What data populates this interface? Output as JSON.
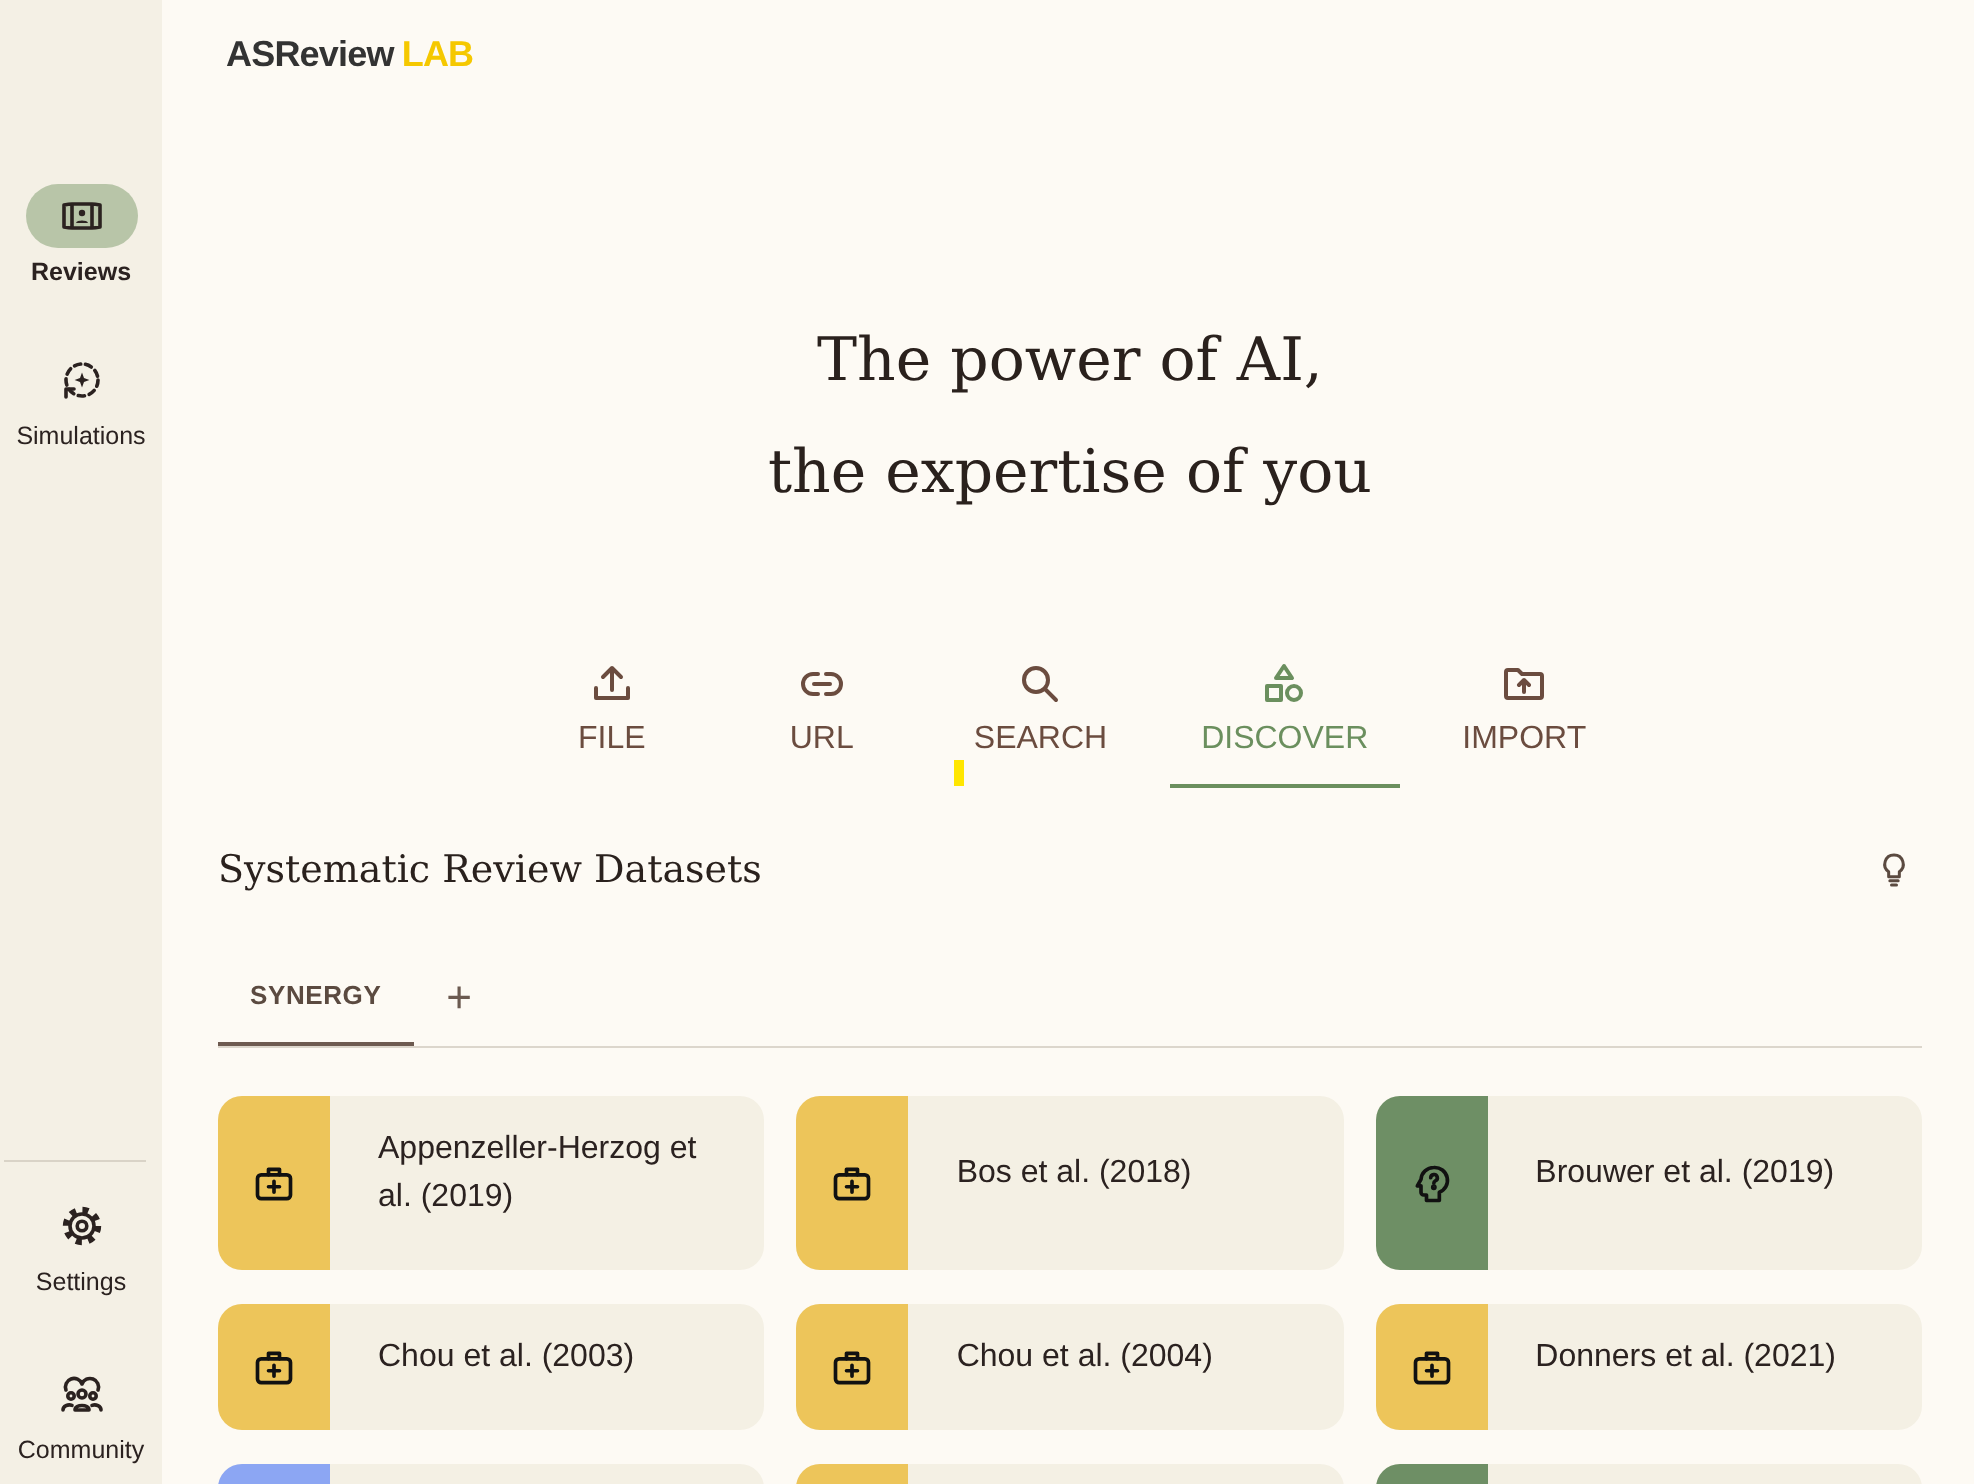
{
  "sidebar": {
    "items": [
      {
        "label": "Reviews",
        "selected": true
      },
      {
        "label": "Simulations",
        "selected": false
      }
    ],
    "bottom_items": [
      {
        "label": "Settings"
      },
      {
        "label": "Community"
      }
    ]
  },
  "logo": {
    "name": "ASReview",
    "suffix": "LAB"
  },
  "headline": [
    "The power of AI,",
    "the expertise of you"
  ],
  "source_tabs": [
    {
      "label": "FILE",
      "selected": false
    },
    {
      "label": "URL",
      "selected": false
    },
    {
      "label": "SEARCH",
      "selected": false
    },
    {
      "label": "DISCOVER",
      "selected": true
    },
    {
      "label": "IMPORT",
      "selected": false
    }
  ],
  "section": {
    "title": "Systematic Review Datasets"
  },
  "dataset_tabs": [
    {
      "label": "SYNERGY",
      "selected": true
    },
    {
      "label": "+",
      "selected": false
    }
  ],
  "datasets": [
    {
      "title": "Appenzeller-Herzog et al. (2019)",
      "kind": "medicine",
      "color": "#edc55a"
    },
    {
      "title": "Bos et al. (2018)",
      "kind": "medicine",
      "color": "#edc55a"
    },
    {
      "title": "Brouwer et al. (2019)",
      "kind": "psychology",
      "color": "#6e8f65"
    },
    {
      "title": "Chou et al. (2003)",
      "kind": "medicine",
      "color": "#edc55a"
    },
    {
      "title": "Chou et al. (2004)",
      "kind": "medicine",
      "color": "#edc55a"
    },
    {
      "title": "Donners et al. (2021)",
      "kind": "medicine",
      "color": "#edc55a"
    },
    {
      "color": "#8ca6f3"
    },
    {
      "color": "#edc55a"
    },
    {
      "color": "#6e8f65"
    }
  ]
}
